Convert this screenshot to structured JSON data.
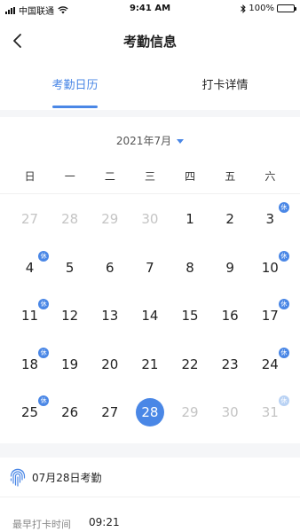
{
  "status_bar": {
    "carrier": "中国联通",
    "time": "9:41 AM",
    "battery": "100%",
    "battery_level": 1.0
  },
  "nav": {
    "title": "考勤信息"
  },
  "tabs": [
    {
      "label": "考勤日历"
    },
    {
      "label": "打卡详情"
    }
  ],
  "calendar": {
    "month_label": "2021年7月",
    "weekdays": [
      "日",
      "一",
      "二",
      "三",
      "四",
      "五",
      "六"
    ],
    "days": [
      {
        "n": "27",
        "muted": true
      },
      {
        "n": "28",
        "muted": true
      },
      {
        "n": "29",
        "muted": true
      },
      {
        "n": "30",
        "muted": true
      },
      {
        "n": "1"
      },
      {
        "n": "2"
      },
      {
        "n": "3",
        "rest": "休"
      },
      {
        "n": "4",
        "rest": "休"
      },
      {
        "n": "5"
      },
      {
        "n": "6"
      },
      {
        "n": "7"
      },
      {
        "n": "8"
      },
      {
        "n": "9"
      },
      {
        "n": "10",
        "rest": "休"
      },
      {
        "n": "11",
        "rest": "休"
      },
      {
        "n": "12"
      },
      {
        "n": "13"
      },
      {
        "n": "14"
      },
      {
        "n": "15"
      },
      {
        "n": "16"
      },
      {
        "n": "17",
        "rest": "休"
      },
      {
        "n": "18",
        "rest": "休"
      },
      {
        "n": "19"
      },
      {
        "n": "20"
      },
      {
        "n": "21"
      },
      {
        "n": "22"
      },
      {
        "n": "23"
      },
      {
        "n": "24",
        "rest": "休"
      },
      {
        "n": "25",
        "rest": "休"
      },
      {
        "n": "26"
      },
      {
        "n": "27"
      },
      {
        "n": "28",
        "selected": true
      },
      {
        "n": "29",
        "muted": true
      },
      {
        "n": "30",
        "muted": true
      },
      {
        "n": "31",
        "muted": true,
        "rest": "休"
      }
    ]
  },
  "attendance": {
    "title": "07月28日考勤",
    "earliest_label": "最早打卡时间",
    "earliest_value": "09:21"
  },
  "colors": {
    "accent": "#4a87e6",
    "muted": "#c4c4c4"
  },
  "icons": {
    "back": "chevron-left-icon",
    "fingerprint": "fingerprint-icon",
    "dropdown": "caret-down-icon"
  }
}
